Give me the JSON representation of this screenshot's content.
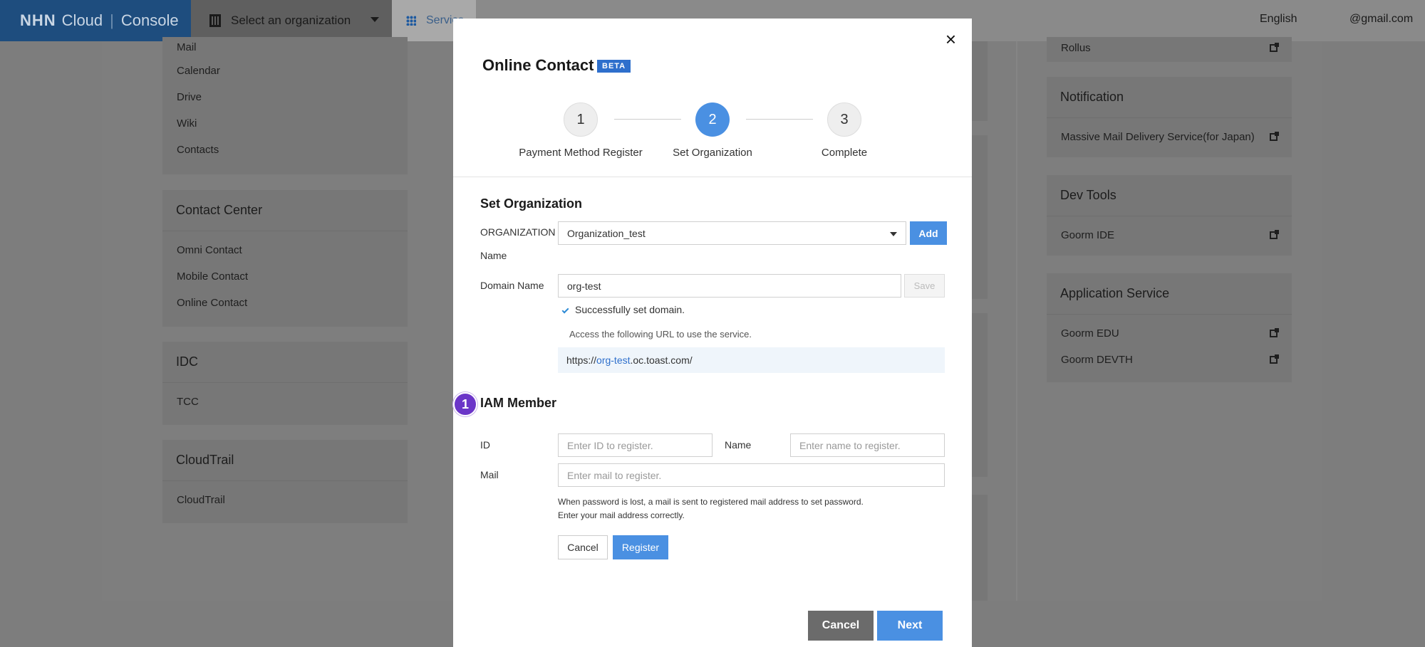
{
  "topbar": {
    "brand_logo": "NHN",
    "brand_cloud": "Cloud",
    "brand_sep": "|",
    "brand_console": "Console",
    "org_selector": "Select an organization",
    "services_tab": "Service",
    "language": "English",
    "user_email": "@gmail.com"
  },
  "left_cards": [
    {
      "items": [
        "Mail",
        "Calendar",
        "Drive",
        "Wiki",
        "Contacts"
      ]
    },
    {
      "title": "Contact Center",
      "items": [
        "Omni Contact",
        "Mobile Contact",
        "Online Contact"
      ]
    },
    {
      "title": "IDC",
      "items": [
        "TCC"
      ]
    },
    {
      "title": "CloudTrail",
      "items": [
        "CloudTrail"
      ]
    }
  ],
  "right_cards": [
    {
      "items": [
        "Rollus"
      ]
    },
    {
      "title": "Notification",
      "items": [
        "Massive Mail Delivery Service(for Japan)"
      ]
    },
    {
      "title": "Dev Tools",
      "items": [
        "Goorm IDE"
      ]
    },
    {
      "title": "Application Service",
      "items": [
        "Goorm EDU",
        "Goorm DEVTH"
      ]
    }
  ],
  "modal": {
    "title": "Online Contact",
    "badge": "BETA",
    "close_symbol": "×",
    "steps": [
      {
        "number": "1",
        "label": "Payment Method Register"
      },
      {
        "number": "2",
        "label": "Set Organization"
      },
      {
        "number": "3",
        "label": "Complete"
      }
    ],
    "set_org": {
      "section_title": "Set Organization",
      "org_label_line1": "ORGANIZATION",
      "org_label_line2": "Name",
      "org_value": "Organization_test",
      "add_button": "Add",
      "domain_label": "Domain Name",
      "domain_value": "org-test",
      "save_button": "Save",
      "success_message": "Successfully set domain.",
      "access_hint": "Access the following URL to use the service.",
      "url_prefix": "https://",
      "url_domain": "org-test",
      "url_suffix": ".oc.toast.com/"
    },
    "iam": {
      "section_title": "IAM Member",
      "marker_number": "1",
      "id_label": "ID",
      "id_placeholder": "Enter ID to register.",
      "name_label": "Name",
      "name_placeholder": "Enter name to register.",
      "mail_label": "Mail",
      "mail_placeholder": "Enter mail to register.",
      "hint_line1": "When password is lost, a mail is sent to registered mail address to set password.",
      "hint_line2": "Enter your mail address correctly.",
      "cancel_button": "Cancel",
      "register_button": "Register"
    },
    "footer": {
      "cancel_button": "Cancel",
      "next_button": "Next"
    }
  },
  "colors": {
    "primary_blue": "#4a90e2",
    "brand_navy": "#1e4d7e",
    "marker_purple": "#6b35c8",
    "overlay_gray": "#7d7d7d"
  }
}
